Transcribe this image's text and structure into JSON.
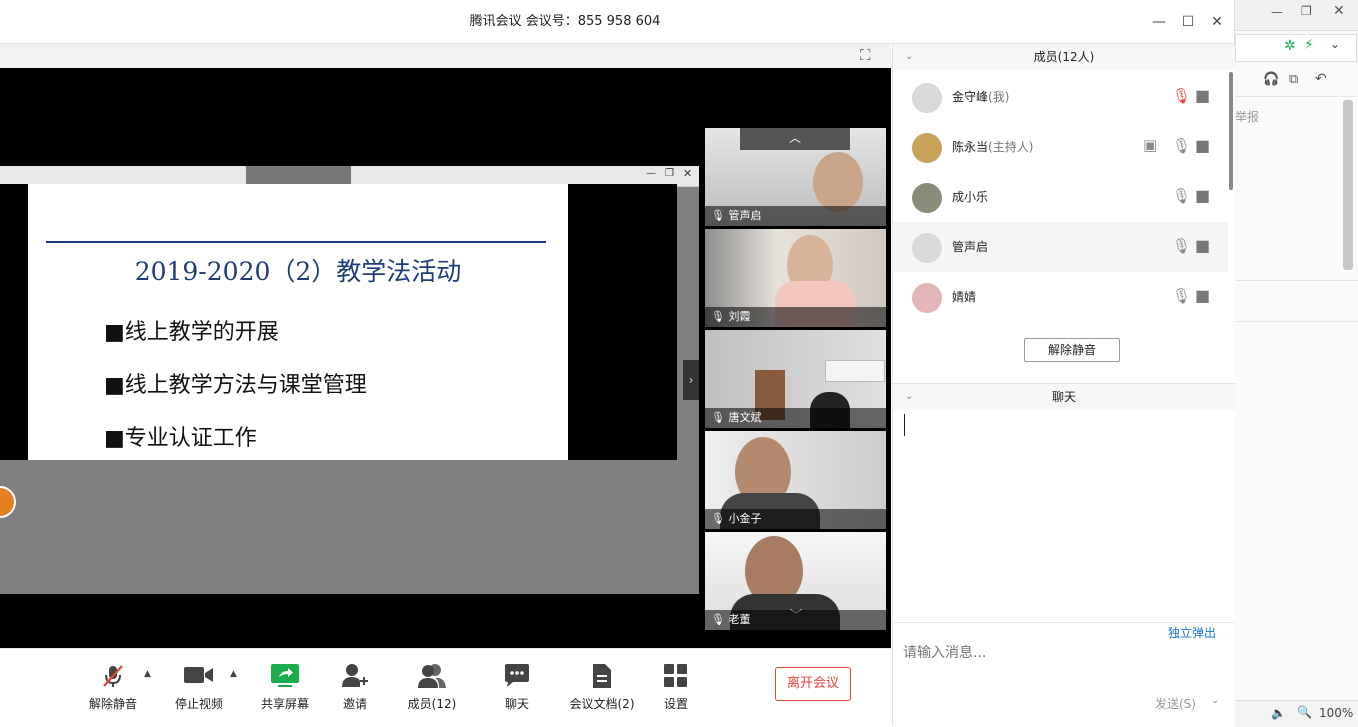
{
  "window": {
    "title": "腾讯会议 会议号：855 958 604"
  },
  "slide": {
    "title": "2019-2020（2）教学法活动",
    "bullets": [
      "■线上教学的开展",
      "■线上教学方法与课堂管理",
      "■专业认证工作"
    ]
  },
  "tiles": [
    {
      "name": "管声启"
    },
    {
      "name": "刘霞"
    },
    {
      "name": "唐文斌"
    },
    {
      "name": "小金子"
    },
    {
      "name": "老董"
    }
  ],
  "members": {
    "header": "成员(12人)",
    "list": [
      {
        "name": "金守峰",
        "role": "(我)",
        "mic": "muted"
      },
      {
        "name": "陈永当",
        "role": "(主持人)",
        "mic": "on",
        "sharing": true
      },
      {
        "name": "成小乐",
        "role": "",
        "mic": "on"
      },
      {
        "name": "管声启",
        "role": "",
        "mic": "on"
      },
      {
        "name": "婧婧",
        "role": "",
        "mic": "on"
      }
    ],
    "unmute_button": "解除静音"
  },
  "chat": {
    "header": "聊天",
    "popout": "独立弹出",
    "placeholder": "请输入消息...",
    "send": "发送(S)"
  },
  "toolbar": {
    "unmute": "解除静音",
    "stop_video": "停止视频",
    "share": "共享屏幕",
    "invite": "邀请",
    "members": "成员(12)",
    "chat": "聊天",
    "docs": "会议文档(2)",
    "settings": "设置",
    "leave": "离开会议"
  },
  "bgapp": {
    "text": "举报",
    "zoom": "100%"
  },
  "colors": {
    "accent": "#1a6fd1",
    "leave": "#e0453a",
    "share_green": "#1aad4b",
    "slide_blue": "#1f3b7a"
  }
}
